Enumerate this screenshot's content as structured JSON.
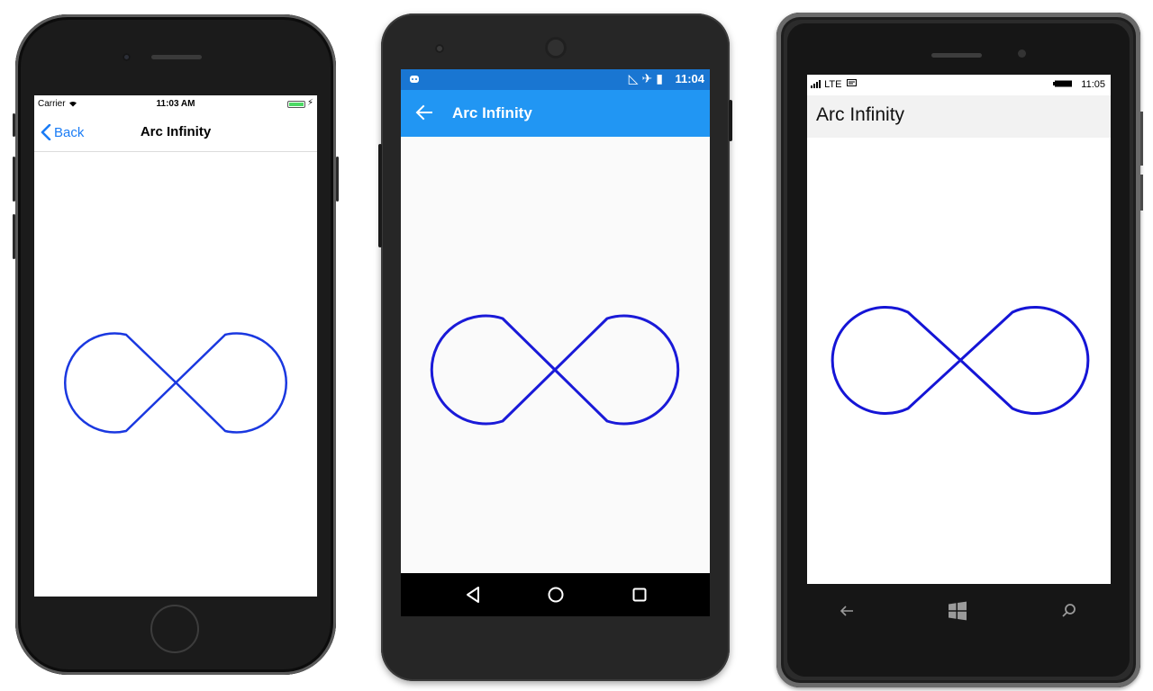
{
  "ios": {
    "carrier": "Carrier",
    "time": "11:03 AM",
    "back_label": "Back",
    "title": "Arc Infinity"
  },
  "android": {
    "time": "11:04",
    "title": "Arc Infinity"
  },
  "windows": {
    "network": "LTE",
    "time": "11:05",
    "title": "Arc Infinity"
  },
  "colors": {
    "infinity_stroke": "#1a38e0",
    "ios_accent": "#1a7cf5",
    "android_primary": "#2196f3",
    "android_status": "#1976d2"
  },
  "icons": [
    "back-chevron-icon",
    "wifi-icon",
    "battery-icon",
    "robot-icon",
    "airplane-icon",
    "back-arrow-icon",
    "nav-back-icon",
    "nav-home-icon",
    "nav-recents-icon",
    "signal-icon",
    "message-icon",
    "windows-logo-icon",
    "search-icon"
  ]
}
